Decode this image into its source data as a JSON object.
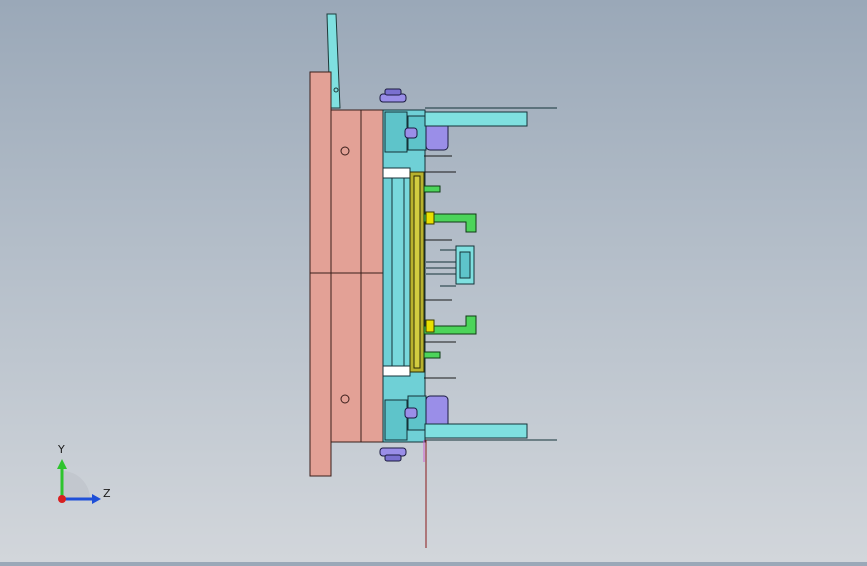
{
  "triad": {
    "y_label": "Y",
    "z_label": "Z"
  },
  "colors": {
    "background_top": "#9aa8b8",
    "background_bottom": "#d2d6db",
    "clamp_plate": "#e3a196",
    "cavity_plate": "#6fd0d6",
    "part": "#b8b22e",
    "ejector": "#4cd45a",
    "cylinder": "#9a8ee8",
    "highlight_yellow": "#e8e000",
    "y_axis": "#2ec42e",
    "z_axis": "#1e4fd8",
    "x_axis": "#d82020"
  },
  "icons": [
    "view-orientation-triad-icon"
  ]
}
